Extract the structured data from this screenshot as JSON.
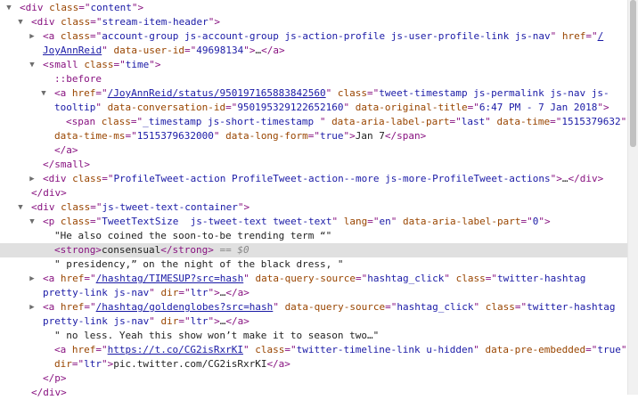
{
  "elements_panel": {
    "expanded_glyph": "▼",
    "collapsed_glyph": "▶",
    "lines": [
      {
        "indent": 0,
        "toggle": "expanded",
        "segments": [
          {
            "k": "tag",
            "t": "<div "
          },
          {
            "k": "an",
            "t": "class"
          },
          {
            "k": "tag",
            "t": "=\""
          },
          {
            "k": "av",
            "t": "content"
          },
          {
            "k": "tag",
            "t": "\">"
          }
        ]
      },
      {
        "indent": 1,
        "toggle": "expanded",
        "segments": [
          {
            "k": "tag",
            "t": "<div "
          },
          {
            "k": "an",
            "t": "class"
          },
          {
            "k": "tag",
            "t": "=\""
          },
          {
            "k": "av",
            "t": "stream-item-header"
          },
          {
            "k": "tag",
            "t": "\">"
          }
        ]
      },
      {
        "indent": 2,
        "toggle": "collapsed",
        "segments": [
          {
            "k": "tag",
            "t": "<a "
          },
          {
            "k": "an",
            "t": "class"
          },
          {
            "k": "tag",
            "t": "=\""
          },
          {
            "k": "av",
            "t": "account-group js-account-group js-action-profile js-user-profile-link js-nav"
          },
          {
            "k": "tag",
            "t": "\" "
          },
          {
            "k": "an",
            "t": "href"
          },
          {
            "k": "tag",
            "t": "=\""
          },
          {
            "k": "av link",
            "t": "/"
          }
        ]
      },
      {
        "indent": 2,
        "toggle": "none",
        "segments": [
          {
            "k": "av link",
            "t": "JoyAnnReid"
          },
          {
            "k": "tag",
            "t": "\" "
          },
          {
            "k": "an",
            "t": "data-user-id"
          },
          {
            "k": "tag",
            "t": "=\""
          },
          {
            "k": "av",
            "t": "49698134"
          },
          {
            "k": "tag",
            "t": "\">"
          },
          {
            "k": "pl",
            "t": "…"
          },
          {
            "k": "tag",
            "t": "</a>"
          }
        ]
      },
      {
        "indent": 2,
        "toggle": "expanded",
        "segments": [
          {
            "k": "tag",
            "t": "<small "
          },
          {
            "k": "an",
            "t": "class"
          },
          {
            "k": "tag",
            "t": "=\""
          },
          {
            "k": "av",
            "t": "time"
          },
          {
            "k": "tag",
            "t": "\">"
          }
        ]
      },
      {
        "indent": 3,
        "toggle": "none",
        "segments": [
          {
            "k": "ps",
            "t": "::before"
          }
        ]
      },
      {
        "indent": 3,
        "toggle": "expanded",
        "segments": [
          {
            "k": "tag",
            "t": "<a "
          },
          {
            "k": "an",
            "t": "href"
          },
          {
            "k": "tag",
            "t": "=\""
          },
          {
            "k": "av link",
            "t": "/JoyAnnReid/status/950197165883842560"
          },
          {
            "k": "tag",
            "t": "\" "
          },
          {
            "k": "an",
            "t": "class"
          },
          {
            "k": "tag",
            "t": "=\""
          },
          {
            "k": "av",
            "t": "tweet-timestamp js-permalink js-nav js-"
          }
        ]
      },
      {
        "indent": 3,
        "toggle": "none",
        "segments": [
          {
            "k": "av",
            "t": "tooltip"
          },
          {
            "k": "tag",
            "t": "\" "
          },
          {
            "k": "an",
            "t": "data-conversation-id"
          },
          {
            "k": "tag",
            "t": "=\""
          },
          {
            "k": "av",
            "t": "950195329122652160"
          },
          {
            "k": "tag",
            "t": "\" "
          },
          {
            "k": "an",
            "t": "data-original-title"
          },
          {
            "k": "tag",
            "t": "=\""
          },
          {
            "k": "av",
            "t": "6:47 PM - 7 Jan 2018"
          },
          {
            "k": "tag",
            "t": "\">"
          }
        ]
      },
      {
        "indent": 4,
        "toggle": "none",
        "segments": [
          {
            "k": "tag",
            "t": "<span "
          },
          {
            "k": "an",
            "t": "class"
          },
          {
            "k": "tag",
            "t": "=\""
          },
          {
            "k": "av",
            "t": "_timestamp js-short-timestamp "
          },
          {
            "k": "tag",
            "t": "\" "
          },
          {
            "k": "an",
            "t": "data-aria-label-part"
          },
          {
            "k": "tag",
            "t": "=\""
          },
          {
            "k": "av",
            "t": "last"
          },
          {
            "k": "tag",
            "t": "\" "
          },
          {
            "k": "an",
            "t": "data-time"
          },
          {
            "k": "tag",
            "t": "=\""
          },
          {
            "k": "av",
            "t": "1515379632"
          },
          {
            "k": "tag",
            "t": "\""
          }
        ]
      },
      {
        "indent": 3,
        "toggle": "none",
        "segments": [
          {
            "k": "an",
            "t": "data-time-ms"
          },
          {
            "k": "tag",
            "t": "=\""
          },
          {
            "k": "av",
            "t": "1515379632000"
          },
          {
            "k": "tag",
            "t": "\" "
          },
          {
            "k": "an",
            "t": "data-long-form"
          },
          {
            "k": "tag",
            "t": "=\""
          },
          {
            "k": "av",
            "t": "true"
          },
          {
            "k": "tag",
            "t": "\">"
          },
          {
            "k": "pl",
            "t": "Jan 7"
          },
          {
            "k": "tag",
            "t": "</span>"
          }
        ]
      },
      {
        "indent": 3,
        "toggle": "none",
        "segments": [
          {
            "k": "tag",
            "t": "</a>"
          }
        ]
      },
      {
        "indent": 2,
        "toggle": "none",
        "segments": [
          {
            "k": "tag",
            "t": "</small>"
          }
        ]
      },
      {
        "indent": 2,
        "toggle": "collapsed",
        "segments": [
          {
            "k": "tag",
            "t": "<div "
          },
          {
            "k": "an",
            "t": "class"
          },
          {
            "k": "tag",
            "t": "=\""
          },
          {
            "k": "av",
            "t": "ProfileTweet-action ProfileTweet-action--more js-more-ProfileTweet-actions"
          },
          {
            "k": "tag",
            "t": "\">"
          },
          {
            "k": "pl",
            "t": "…"
          },
          {
            "k": "tag",
            "t": "</div>"
          }
        ]
      },
      {
        "indent": 1,
        "toggle": "none",
        "segments": [
          {
            "k": "tag",
            "t": "</div>"
          }
        ]
      },
      {
        "indent": 1,
        "toggle": "expanded",
        "segments": [
          {
            "k": "tag",
            "t": "<div "
          },
          {
            "k": "an",
            "t": "class"
          },
          {
            "k": "tag",
            "t": "=\""
          },
          {
            "k": "av",
            "t": "js-tweet-text-container"
          },
          {
            "k": "tag",
            "t": "\">"
          }
        ]
      },
      {
        "indent": 2,
        "toggle": "expanded",
        "segments": [
          {
            "k": "tag",
            "t": "<p "
          },
          {
            "k": "an",
            "t": "class"
          },
          {
            "k": "tag",
            "t": "=\""
          },
          {
            "k": "av",
            "t": "TweetTextSize  js-tweet-text tweet-text"
          },
          {
            "k": "tag",
            "t": "\" "
          },
          {
            "k": "an",
            "t": "lang"
          },
          {
            "k": "tag",
            "t": "=\""
          },
          {
            "k": "av",
            "t": "en"
          },
          {
            "k": "tag",
            "t": "\" "
          },
          {
            "k": "an",
            "t": "data-aria-label-part"
          },
          {
            "k": "tag",
            "t": "=\""
          },
          {
            "k": "av",
            "t": "0"
          },
          {
            "k": "tag",
            "t": "\">"
          }
        ]
      },
      {
        "indent": 3,
        "toggle": "none",
        "segments": [
          {
            "k": "pl",
            "t": "\"He also coined the soon-to-be trending term “\""
          }
        ]
      },
      {
        "indent": 3,
        "toggle": "none",
        "selected": true,
        "segments": [
          {
            "k": "tag",
            "t": "<strong>"
          },
          {
            "k": "pl",
            "t": "consensual"
          },
          {
            "k": "tag",
            "t": "</strong>"
          },
          {
            "k": "dim",
            "t": " == $0"
          }
        ]
      },
      {
        "indent": 3,
        "toggle": "none",
        "segments": [
          {
            "k": "pl",
            "t": "\" presidency,” on the night of the black dress, \""
          }
        ]
      },
      {
        "indent": 2,
        "toggle": "collapsed",
        "segments": [
          {
            "k": "tag",
            "t": "<a "
          },
          {
            "k": "an",
            "t": "href"
          },
          {
            "k": "tag",
            "t": "=\""
          },
          {
            "k": "av link",
            "t": "/hashtag/TIMESUP?src=hash"
          },
          {
            "k": "tag",
            "t": "\" "
          },
          {
            "k": "an",
            "t": "data-query-source"
          },
          {
            "k": "tag",
            "t": "=\""
          },
          {
            "k": "av",
            "t": "hashtag_click"
          },
          {
            "k": "tag",
            "t": "\" "
          },
          {
            "k": "an",
            "t": "class"
          },
          {
            "k": "tag",
            "t": "=\""
          },
          {
            "k": "av",
            "t": "twitter-hashtag"
          }
        ]
      },
      {
        "indent": 2,
        "toggle": "none",
        "segments": [
          {
            "k": "av",
            "t": "pretty-link js-nav"
          },
          {
            "k": "tag",
            "t": "\" "
          },
          {
            "k": "an",
            "t": "dir"
          },
          {
            "k": "tag",
            "t": "=\""
          },
          {
            "k": "av",
            "t": "ltr"
          },
          {
            "k": "tag",
            "t": "\">"
          },
          {
            "k": "pl",
            "t": "…"
          },
          {
            "k": "tag",
            "t": "</a>"
          }
        ]
      },
      {
        "indent": 2,
        "toggle": "collapsed",
        "segments": [
          {
            "k": "tag",
            "t": "<a "
          },
          {
            "k": "an",
            "t": "href"
          },
          {
            "k": "tag",
            "t": "=\""
          },
          {
            "k": "av link",
            "t": "/hashtag/goldenglobes?src=hash"
          },
          {
            "k": "tag",
            "t": "\" "
          },
          {
            "k": "an",
            "t": "data-query-source"
          },
          {
            "k": "tag",
            "t": "=\""
          },
          {
            "k": "av",
            "t": "hashtag_click"
          },
          {
            "k": "tag",
            "t": "\" "
          },
          {
            "k": "an",
            "t": "class"
          },
          {
            "k": "tag",
            "t": "=\""
          },
          {
            "k": "av",
            "t": "twitter-hashtag"
          }
        ]
      },
      {
        "indent": 2,
        "toggle": "none",
        "segments": [
          {
            "k": "av",
            "t": "pretty-link js-nav"
          },
          {
            "k": "tag",
            "t": "\" "
          },
          {
            "k": "an",
            "t": "dir"
          },
          {
            "k": "tag",
            "t": "=\""
          },
          {
            "k": "av",
            "t": "ltr"
          },
          {
            "k": "tag",
            "t": "\">"
          },
          {
            "k": "pl",
            "t": "…"
          },
          {
            "k": "tag",
            "t": "</a>"
          }
        ]
      },
      {
        "indent": 3,
        "toggle": "none",
        "segments": [
          {
            "k": "pl",
            "t": "\" no less. Yeah this show won’t make it to season two…\""
          }
        ]
      },
      {
        "indent": 3,
        "toggle": "none",
        "segments": [
          {
            "k": "tag",
            "t": "<a "
          },
          {
            "k": "an",
            "t": "href"
          },
          {
            "k": "tag",
            "t": "=\""
          },
          {
            "k": "av link",
            "t": "https://t.co/CG2isRxrKI"
          },
          {
            "k": "tag",
            "t": "\" "
          },
          {
            "k": "an",
            "t": "class"
          },
          {
            "k": "tag",
            "t": "=\""
          },
          {
            "k": "av",
            "t": "twitter-timeline-link u-hidden"
          },
          {
            "k": "tag",
            "t": "\" "
          },
          {
            "k": "an",
            "t": "data-pre-embedded"
          },
          {
            "k": "tag",
            "t": "=\""
          },
          {
            "k": "av",
            "t": "true"
          },
          {
            "k": "tag",
            "t": "\""
          }
        ]
      },
      {
        "indent": 3,
        "toggle": "none",
        "segments": [
          {
            "k": "an",
            "t": "dir"
          },
          {
            "k": "tag",
            "t": "=\""
          },
          {
            "k": "av",
            "t": "ltr"
          },
          {
            "k": "tag",
            "t": "\">"
          },
          {
            "k": "pl",
            "t": "pic.twitter.com/CG2isRxrKI"
          },
          {
            "k": "tag",
            "t": "</a>"
          }
        ]
      },
      {
        "indent": 2,
        "toggle": "none",
        "segments": [
          {
            "k": "tag",
            "t": "</p>"
          }
        ]
      },
      {
        "indent": 1,
        "toggle": "none",
        "segments": [
          {
            "k": "tag",
            "t": "</div>"
          }
        ]
      }
    ]
  }
}
